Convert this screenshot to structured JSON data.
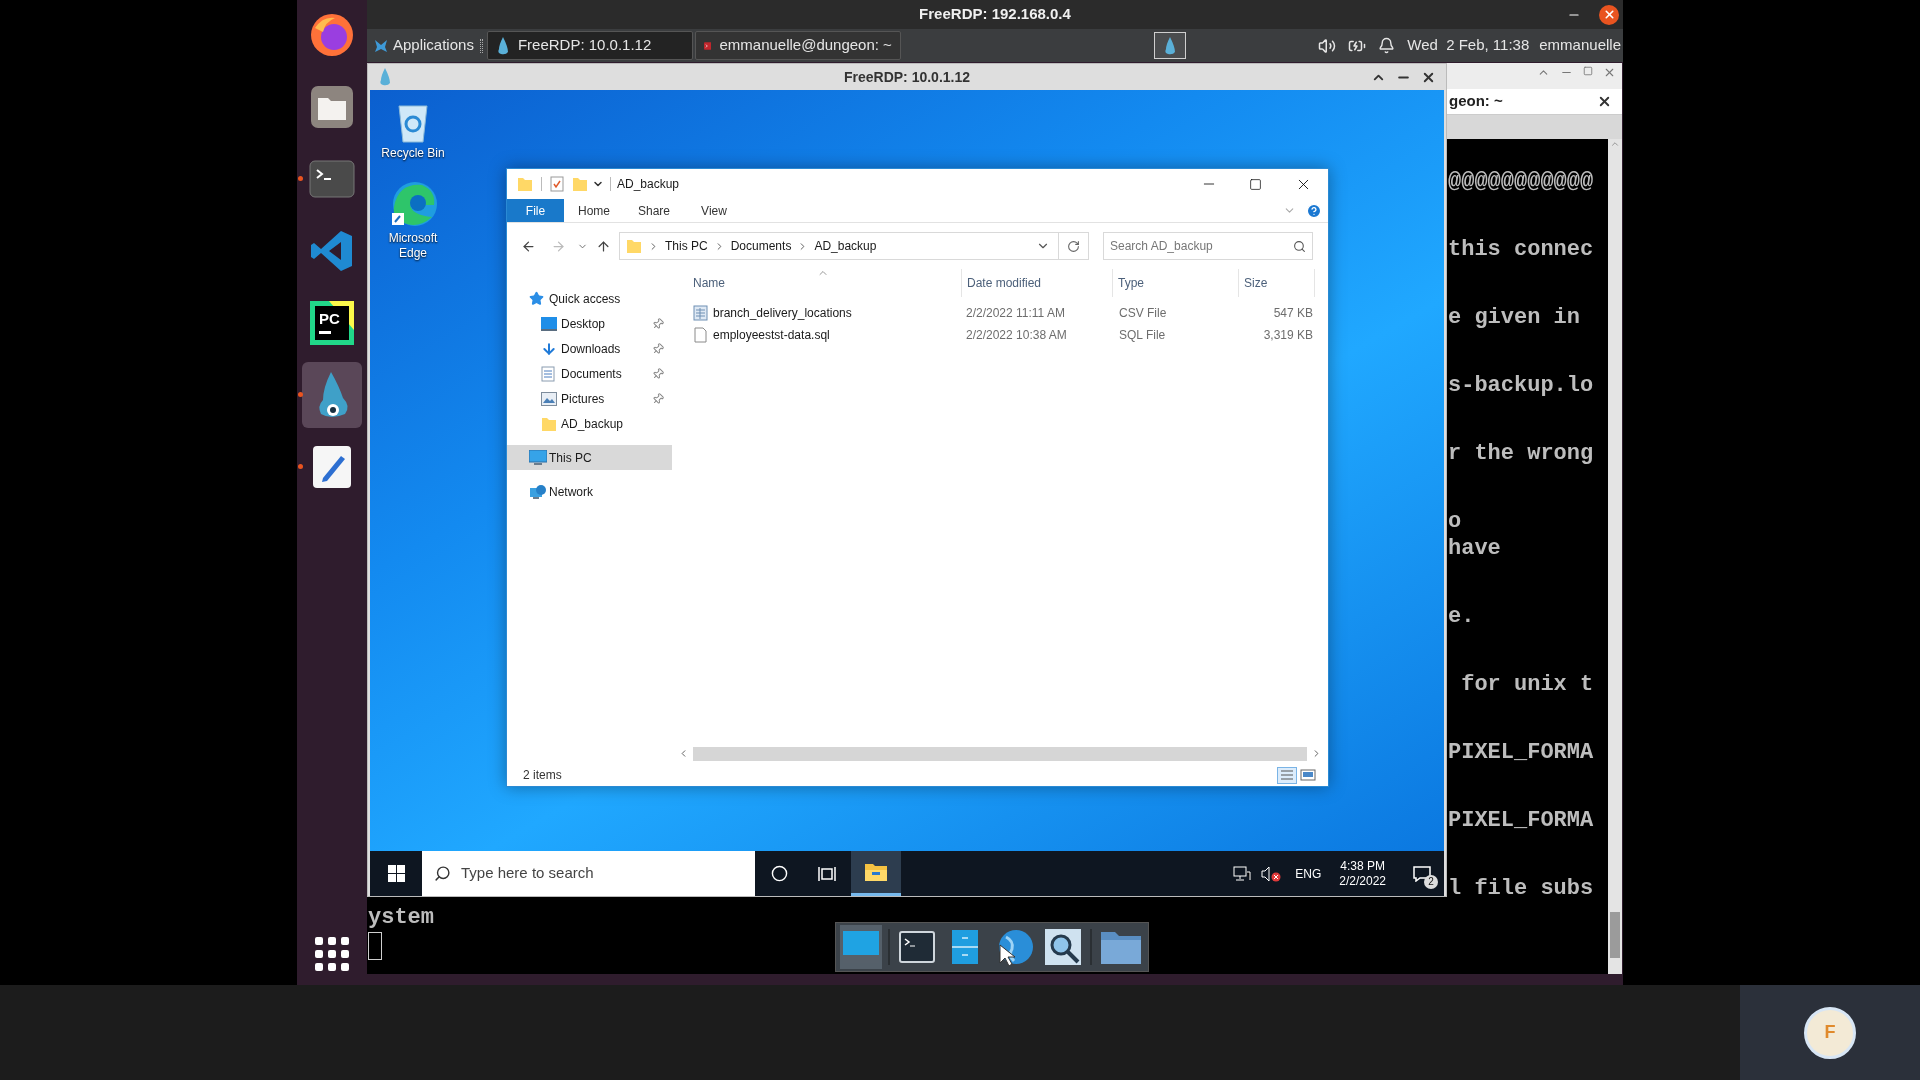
{
  "host_window": {
    "title": "FreeRDP: 192.168.0.4"
  },
  "dock": [
    {
      "kind": "firefox",
      "running": false,
      "selected": false
    },
    {
      "kind": "files",
      "running": false,
      "selected": false
    },
    {
      "kind": "terminal",
      "running": true,
      "selected": false
    },
    {
      "kind": "vscode",
      "running": false,
      "selected": false
    },
    {
      "kind": "pycharm",
      "running": false,
      "selected": false,
      "logo_text": "PC"
    },
    {
      "kind": "freerdp",
      "running": true,
      "selected": true
    },
    {
      "kind": "editor",
      "running": true,
      "selected": false
    }
  ],
  "panel": {
    "menu": "Applications",
    "tasks": [
      {
        "title": "FreeRDP: 10.0.1.12",
        "kind": "freerdp",
        "selected": true
      },
      {
        "title": "emmanuelle@dungeon: ~",
        "kind": "terminal",
        "selected": false
      }
    ],
    "clock": "Wed  2 Feb, 11:38",
    "user": "emmanuelle"
  },
  "terminal": {
    "tab_title": "geon: ~",
    "blocks": [
      [
        "@@@@@@@@@@@"
      ],
      [
        "this connec"
      ],
      [
        "e given in"
      ],
      [
        "s-backup.lo"
      ],
      [
        "r the wrong"
      ],
      [
        "o",
        "have"
      ],
      [
        "e."
      ],
      [
        " for unix t"
      ],
      [
        "PIXEL_FORMA"
      ],
      [
        "PIXEL_FORMA"
      ],
      [
        "l file subs"
      ]
    ],
    "bottom_lines": [
      "ystem"
    ]
  },
  "rdp_window": {
    "title": "FreeRDP: 10.0.1.12"
  },
  "desktop_icons": [
    {
      "label": "Recycle Bin",
      "kind": "recycle"
    },
    {
      "label": "Microsoft Edge",
      "kind": "edge"
    }
  ],
  "explorer": {
    "title": "AD_backup",
    "ribbon_tabs": [
      {
        "label": "File",
        "selected": true
      },
      {
        "label": "Home",
        "selected": false
      },
      {
        "label": "Share",
        "selected": false
      },
      {
        "label": "View",
        "selected": false
      }
    ],
    "breadcrumb": [
      "This PC",
      "Documents",
      "AD_backup"
    ],
    "search_placeholder": "Search AD_backup",
    "nav": [
      {
        "label": "Quick access",
        "kind": "star",
        "selected": false,
        "children": [
          {
            "label": "Desktop",
            "kind": "desktop",
            "pinned": true,
            "selected": false
          },
          {
            "label": "Downloads",
            "kind": "download",
            "pinned": true,
            "selected": false
          },
          {
            "label": "Documents",
            "kind": "documents",
            "pinned": true,
            "selected": false
          },
          {
            "label": "Pictures",
            "kind": "pictures",
            "pinned": true,
            "selected": false
          },
          {
            "label": "AD_backup",
            "kind": "folder",
            "pinned": false,
            "selected": false
          }
        ]
      },
      {
        "label": "This PC",
        "kind": "pc",
        "selected": true
      },
      {
        "label": "Network",
        "kind": "network",
        "selected": false
      }
    ],
    "columns": [
      "Name",
      "Date modified",
      "Type",
      "Size"
    ],
    "rows": [
      {
        "name": "branch_delivery_locations",
        "kind": "csv",
        "date": "2/2/2022 11:11 AM",
        "type": "CSV File",
        "size": "547 KB"
      },
      {
        "name": "employeestst-data.sql",
        "kind": "sql",
        "date": "2/2/2022 10:38 AM",
        "type": "SQL File",
        "size": "3,319 KB"
      }
    ],
    "status": "2 items"
  },
  "taskbar": {
    "search_placeholder": "Type here to search",
    "apps": [
      {
        "kind": "explorer",
        "selected": true
      }
    ],
    "language": "ENG",
    "time": "4:38 PM",
    "date": "2/2/2022",
    "notifications": "2"
  },
  "bottom_dock": [
    {
      "kind": "desktop",
      "selected": true
    },
    {
      "kind": "terminal",
      "selected": false
    },
    {
      "kind": "cabinet",
      "selected": false
    },
    {
      "kind": "globe",
      "selected": false
    },
    {
      "kind": "finder",
      "selected": false
    },
    {
      "kind": "folder",
      "selected": false
    }
  ],
  "user_badge": "F"
}
